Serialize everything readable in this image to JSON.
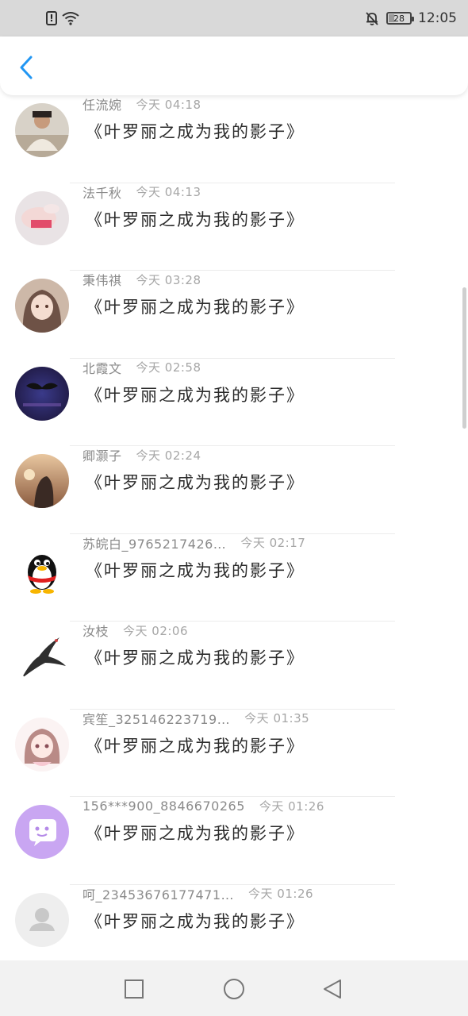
{
  "status_bar": {
    "time": "12:05",
    "battery_level": "28",
    "icons": [
      "alert-icon",
      "wifi-icon",
      "bell-off-icon",
      "battery-icon"
    ]
  },
  "header": {
    "back_icon": "chevron-left-icon",
    "accent_color": "#2196f3"
  },
  "comments": [
    {
      "name": "任流婉",
      "time": "今天 04:18",
      "message": "《叶罗丽之成为我的影子》",
      "avatar": "photo-person-avatar"
    },
    {
      "name": "法千秋",
      "time": "今天 04:13",
      "message": "《叶罗丽之成为我的影子》",
      "avatar": "photo-hands-avatar"
    },
    {
      "name": "秉伟祺",
      "time": "今天 03:28",
      "message": "《叶罗丽之成为我的影子》",
      "avatar": "anime-girl-avatar"
    },
    {
      "name": "北霞文",
      "time": "今天 02:58",
      "message": "《叶罗丽之成为我的影子》",
      "avatar": "mustache-avatar"
    },
    {
      "name": "卿灏子",
      "time": "今天 02:24",
      "message": "《叶罗丽之成为我的影子》",
      "avatar": "sunset-avatar"
    },
    {
      "name": "苏皖白_9765217426…",
      "time": "今天 02:17",
      "message": "《叶罗丽之成为我的影子》",
      "avatar": "qq-penguin-avatar"
    },
    {
      "name": "汝枝",
      "time": "今天 02:06",
      "message": "《叶罗丽之成为我的影子》",
      "avatar": "swallow-bird-avatar"
    },
    {
      "name": "宾笙_325146223719…",
      "time": "今天 01:35",
      "message": "《叶罗丽之成为我的影子》",
      "avatar": "anime-pink-girl-avatar"
    },
    {
      "name": "156***900_8846670265",
      "time": "今天 01:26",
      "message": "《叶罗丽之成为我的影子》",
      "avatar": "purple-chat-avatar"
    },
    {
      "name": "呵_23453676177471…",
      "time": "今天 01:26",
      "message": "《叶罗丽之成为我的影子》",
      "avatar": "default-user-avatar"
    }
  ],
  "nav_bar": {
    "buttons": [
      "recent-apps-square-icon",
      "home-circle-icon",
      "back-triangle-icon"
    ]
  }
}
